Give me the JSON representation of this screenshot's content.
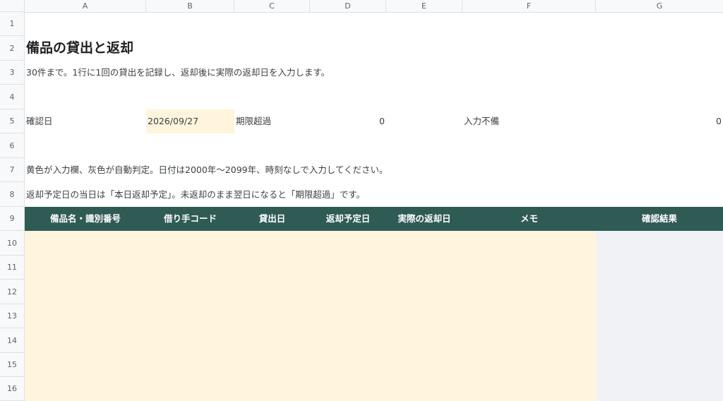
{
  "columns": [
    "A",
    "B",
    "C",
    "D",
    "E",
    "F",
    "G"
  ],
  "rows": [
    "1",
    "2",
    "3",
    "4",
    "5",
    "6",
    "7",
    "8",
    "9",
    "10",
    "11",
    "12",
    "13",
    "14",
    "15",
    "16"
  ],
  "title": "備品の貸出と返却",
  "subtitle": "30件まで。1行に1回の貸出を記録し、返却後に実際の返却日を入力します。",
  "check": {
    "date_label": "確認日",
    "date_value": "2026/09/27",
    "overdue_label": "期限超過",
    "overdue_count": "0",
    "incomplete_label": "入力不備",
    "incomplete_count": "0"
  },
  "notes": [
    "黄色が入力欄、灰色が自動判定。日付は2000年〜2099年、時刻なしで入力してください。",
    "返却予定日の当日は「本日返却予定」。未返却のまま翌日になると「期限超過」です。"
  ],
  "table_headers": [
    "備品名・識別番号",
    "借り手コード",
    "貸出日",
    "返却予定日",
    "実際の返却日",
    "メモ",
    "確認結果"
  ],
  "colors": {
    "header_bg": "#2f5b55",
    "input_fill": "#fff5dc",
    "auto_fill": "#f1f2f6"
  }
}
